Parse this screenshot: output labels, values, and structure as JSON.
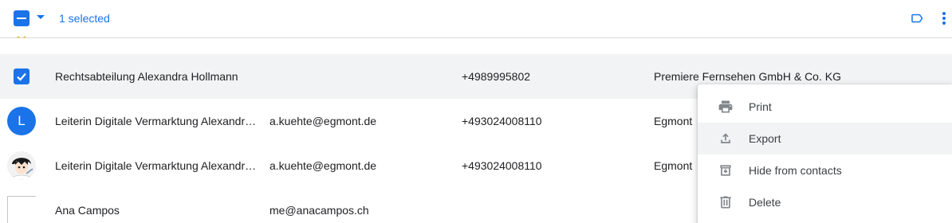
{
  "toolbar": {
    "selection_label": "1 selected",
    "icons": [
      "select-all-checkbox",
      "chevron-down-icon",
      "label-icon",
      "more-vert-icon"
    ],
    "accent_color": "#1a73e8"
  },
  "rows": [
    {
      "name": "Rechtsabteilung Alexandra Hollmann",
      "email": "",
      "phone": "+4989995802",
      "company": "Premiere Fernsehen GmbH & Co. KG",
      "avatar": "checkbox-checked",
      "selected": true
    },
    {
      "name": "Leiterin Digitale Vermarktung Alexandra Kuehte",
      "email": "a.kuehte@egmont.de",
      "phone": "+493024008110",
      "company": "Egmont",
      "avatar": "letter",
      "avatar_letter": "L",
      "selected": false
    },
    {
      "name": "Leiterin Digitale Vermarktung Alexandra Kuehte",
      "email": "a.kuehte@egmont.de",
      "phone": "+493024008110",
      "company": "Egmont",
      "avatar": "photo",
      "selected": false
    },
    {
      "name": "Ana Campos",
      "email": "me@anacampos.ch",
      "phone": "",
      "company": "",
      "avatar": "broken-image",
      "selected": false
    }
  ],
  "menu": {
    "items": [
      {
        "label": "Print",
        "icon": "print-icon"
      },
      {
        "label": "Export",
        "icon": "export-icon",
        "hovered": true
      },
      {
        "label": "Hide from contacts",
        "icon": "hide-contact-icon"
      },
      {
        "label": "Delete",
        "icon": "trash-icon"
      }
    ]
  }
}
